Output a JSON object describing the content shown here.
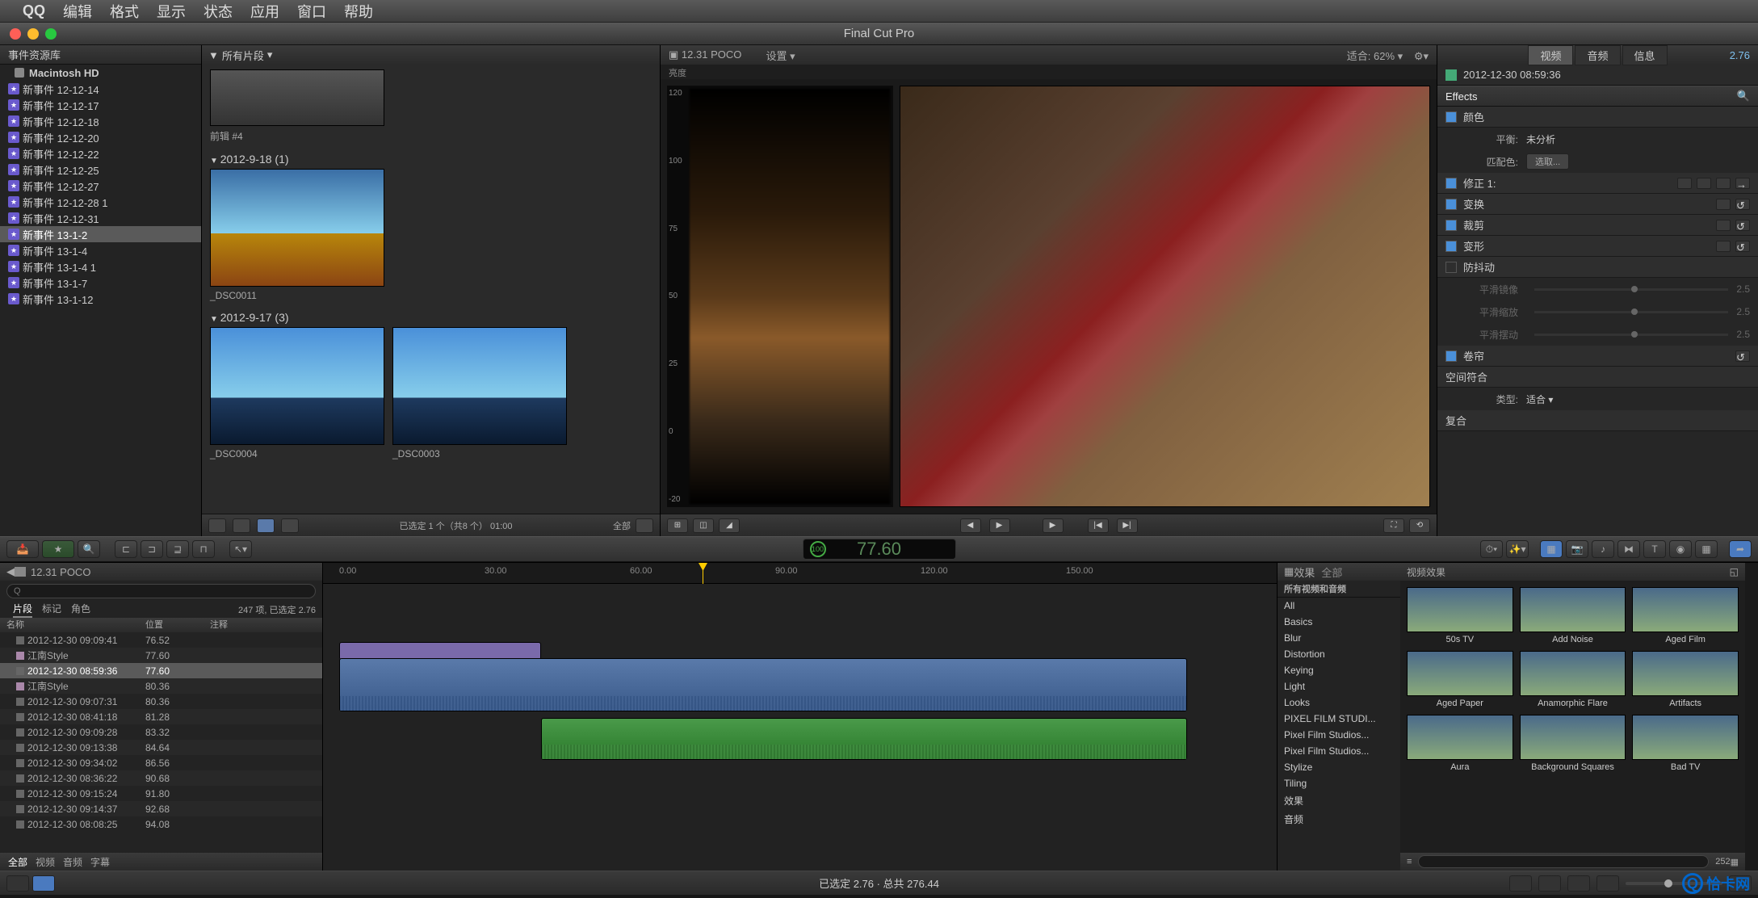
{
  "menubar": {
    "app": "QQ",
    "items": [
      "编辑",
      "格式",
      "显示",
      "状态",
      "应用",
      "窗口",
      "帮助"
    ]
  },
  "window_title": "Final Cut Pro",
  "library": {
    "title": "事件资源库",
    "volume": "Macintosh HD",
    "events": [
      "新事件 12-12-14",
      "新事件 12-12-17",
      "新事件 12-12-18",
      "新事件 12-12-20",
      "新事件 12-12-22",
      "新事件 12-12-25",
      "新事件 12-12-27",
      "新事件 12-12-28 1",
      "新事件 12-12-31",
      "新事件 13-1-2",
      "新事件 13-1-4",
      "新事件 13-1-4 1",
      "新事件 13-1-7",
      "新事件 13-1-12"
    ],
    "selected": "新事件 13-1-2"
  },
  "browser": {
    "header": "所有片段",
    "sections": [
      {
        "title": "",
        "clips": [
          {
            "name": "前辑 #4",
            "prev": true
          }
        ]
      },
      {
        "title": "2012-9-18  (1)",
        "clips": [
          {
            "name": "_DSC0011"
          }
        ]
      },
      {
        "title": "2012-9-17  (3)",
        "clips": [
          {
            "name": "_DSC0004",
            "sky": true
          },
          {
            "name": "_DSC0003",
            "sky": true
          }
        ]
      }
    ],
    "footer_status": "已选定 1 个（共8 个）   01:00",
    "footer_right": "全部"
  },
  "viewer": {
    "title": "12.31  POCO",
    "left_label": "亮度",
    "settings": "设置",
    "fit_label": "适合:",
    "fit_value": "62%",
    "scope_ticks": [
      "120",
      "100",
      "75",
      "50",
      "25",
      "0",
      "-20"
    ]
  },
  "inspector": {
    "tabs": [
      "视频",
      "音频",
      "信息"
    ],
    "active": "视频",
    "duration": "2.76",
    "clip_name": "2012-12-30 08:59:36",
    "effects": "Effects",
    "color": "颜色",
    "balance": {
      "label": "平衡:",
      "value": "未分析"
    },
    "match": {
      "label": "匹配色:",
      "button": "选取..."
    },
    "correction": "修正 1:",
    "transform": "变换",
    "crop": "裁剪",
    "distort": "变形",
    "stabilize": "防抖动",
    "stab_rows": [
      {
        "label": "平滑镜像",
        "val": "2.5"
      },
      {
        "label": "平滑缩放",
        "val": "2.5"
      },
      {
        "label": "平滑摆动",
        "val": "2.5"
      }
    ],
    "rolling": "卷帘",
    "spatial": "空间符合",
    "spatial_type": {
      "label": "类型:",
      "value": "适合"
    },
    "compound": "复合"
  },
  "toolbar": {
    "timecode": "77.60",
    "pct": "100"
  },
  "index": {
    "project": "12.31  POCO",
    "tabs": [
      "片段",
      "标记",
      "角色"
    ],
    "active": "片段",
    "summary": "247 项,  已选定 2.76",
    "cols": [
      "名称",
      "位置",
      "注释"
    ],
    "rows": [
      {
        "name": "2012-12-30 09:09:41",
        "pos": "76.52"
      },
      {
        "name": "江南Style",
        "pos": "77.60",
        "title": true
      },
      {
        "name": "2012-12-30 08:59:36",
        "pos": "77.60",
        "sel": true
      },
      {
        "name": "江南Style",
        "pos": "80.36",
        "title": true
      },
      {
        "name": "2012-12-30 09:07:31",
        "pos": "80.36"
      },
      {
        "name": "2012-12-30 08:41:18",
        "pos": "81.28"
      },
      {
        "name": "2012-12-30 09:09:28",
        "pos": "83.32"
      },
      {
        "name": "2012-12-30 09:13:38",
        "pos": "84.64"
      },
      {
        "name": "2012-12-30 09:34:02",
        "pos": "86.56"
      },
      {
        "name": "2012-12-30 08:36:22",
        "pos": "90.68"
      },
      {
        "name": "2012-12-30 09:15:24",
        "pos": "91.80"
      },
      {
        "name": "2012-12-30 09:14:37",
        "pos": "92.68"
      },
      {
        "name": "2012-12-30 08:08:25",
        "pos": "94.08"
      }
    ],
    "foot": [
      "全部",
      "视频",
      "音频",
      "字幕"
    ]
  },
  "ruler": {
    "ticks": [
      {
        "v": "0.00",
        "p": 0
      },
      {
        "v": "30.00",
        "p": 180
      },
      {
        "v": "60.00",
        "p": 360
      },
      {
        "v": "90.00",
        "p": 540
      },
      {
        "v": "120.00",
        "p": 720
      },
      {
        "v": "150.00",
        "p": 900
      }
    ],
    "playhead": 470
  },
  "fx": {
    "header": "效果",
    "all": "全部",
    "sub": "所有视频和音频",
    "grid_head": "视频效果",
    "cats": [
      "All",
      "Basics",
      "Blur",
      "Distortion",
      "Keying",
      "Light",
      "Looks",
      "PIXEL FILM STUDI...",
      "Pixel Film Studios...",
      "Pixel Film Studios...",
      "Stylize",
      "Tiling",
      "效果",
      "音频"
    ],
    "items": [
      "50s TV",
      "Add Noise",
      "Aged Film",
      "Aged Paper",
      "Anamorphic Flare",
      "Artifacts",
      "Aura",
      "Background Squares",
      "Bad TV"
    ],
    "count": "252"
  },
  "bottombar": {
    "status": "已选定 2.76  ·  总共 276.44"
  },
  "watermark": "恰卡网"
}
